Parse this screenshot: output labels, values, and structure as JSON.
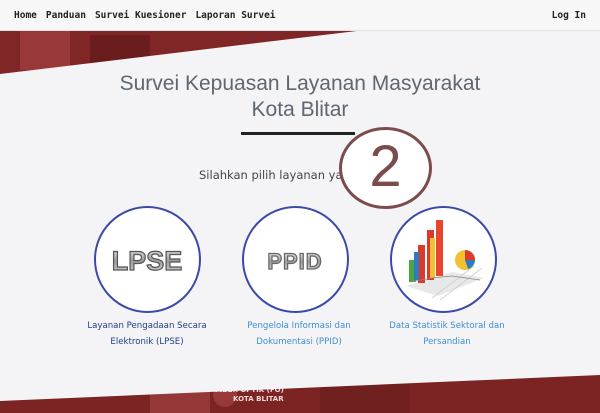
{
  "navbar": {
    "links": [
      "Home",
      "Panduan",
      "Survei Kuesioner",
      "Laporan Survei"
    ],
    "login": "Log In"
  },
  "header": {
    "title_line1": "Survei Kepuasan Layanan Masyarakat",
    "title_line2": "Kota Blitar",
    "subtitle": "Silahkan pilih layanan yang A"
  },
  "services": [
    {
      "logo_text": "LPSE",
      "label_line1": "Layanan Pengadaan Secara",
      "label_line2": "Elektronik (LPSE)",
      "color": "#1f3c88"
    },
    {
      "logo_text": "PPID",
      "label_line1": "Pengelola Informasi dan",
      "label_line2": "Dokumentasi (PPID)",
      "color": "#3f8fd0"
    },
    {
      "logo_text": "",
      "label_line1": "Data Statistik Sektoral dan",
      "label_line2": "Persandian",
      "color": "#3f8fd0"
    }
  ],
  "banner_text": {
    "line1": "FIBER OPTIK (FO)",
    "line2": "KOTA BLITAR"
  },
  "step_badge": "2",
  "colors": {
    "accent": "#3b4aa8",
    "banner": "#9e2f2f",
    "badge": "#7c4b4b"
  }
}
